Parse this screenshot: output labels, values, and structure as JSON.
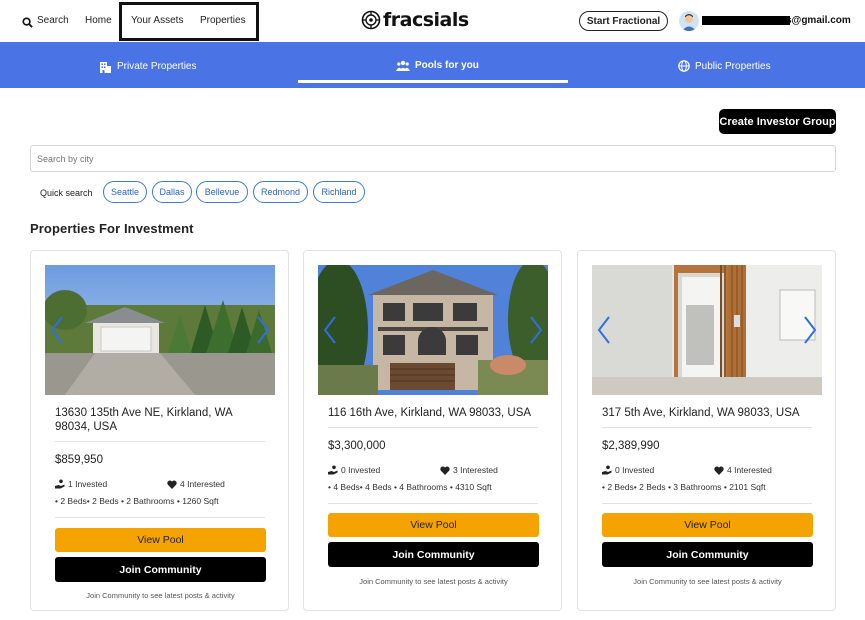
{
  "nav": {
    "search": "Search",
    "home": "Home",
    "your_assets": "Your Assets",
    "properties": "Properties",
    "logo": "fracsials",
    "start_btn": "Start Fractional",
    "email_suffix": "s@gmail.com"
  },
  "tabs": [
    {
      "label": "Private Properties",
      "icon": "building-icon"
    },
    {
      "label": "Pools for you",
      "icon": "people-icon",
      "active": true
    },
    {
      "label": "Public Properties",
      "icon": "globe-icon"
    }
  ],
  "create_group": "Create Investor Group",
  "city_search": {
    "placeholder": "Search by city"
  },
  "quick_search": {
    "label": "Quick search",
    "cities": [
      "Seattle",
      "Dallas",
      "Bellevue",
      "Redmond",
      "Richland"
    ]
  },
  "section_title": "Properties For Investment",
  "properties": [
    {
      "address": "13630 135th Ave NE, Kirkland, WA 98034, USA",
      "price": "$859,950",
      "invested": "1 Invested",
      "interested": "4 Interested",
      "specs": "• 2 Beds• 2 Beds  • 2 Bathrooms   • 1260 Sqft",
      "view": "View Pool",
      "join": "Join Community",
      "note": "Join Community to see latest posts & activity"
    },
    {
      "address": "116 16th Ave, Kirkland, WA 98033, USA",
      "price": "$3,300,000",
      "invested": "0 Invested",
      "interested": "3 Interested",
      "specs": "• 4 Beds• 4 Beds  • 4 Bathrooms   • 4310 Sqft",
      "view": "View Pool",
      "join": "Join Community",
      "note": "Join Community to see latest posts & activity"
    },
    {
      "address": "317 5th Ave, Kirkland, WA 98033, USA",
      "price": "$2,389,990",
      "invested": "0 Invested",
      "interested": "4 Interested",
      "specs": "• 2 Beds• 2 Beds  • 3 Bathrooms   • 2101 Sqft",
      "view": "View Pool",
      "join": "Join Community",
      "note": "Join Community to see latest posts & activity"
    }
  ],
  "colors": {
    "tab_bar": "#4a74e6",
    "view_btn": "#f5a300",
    "chip": "#3a7bd5"
  }
}
